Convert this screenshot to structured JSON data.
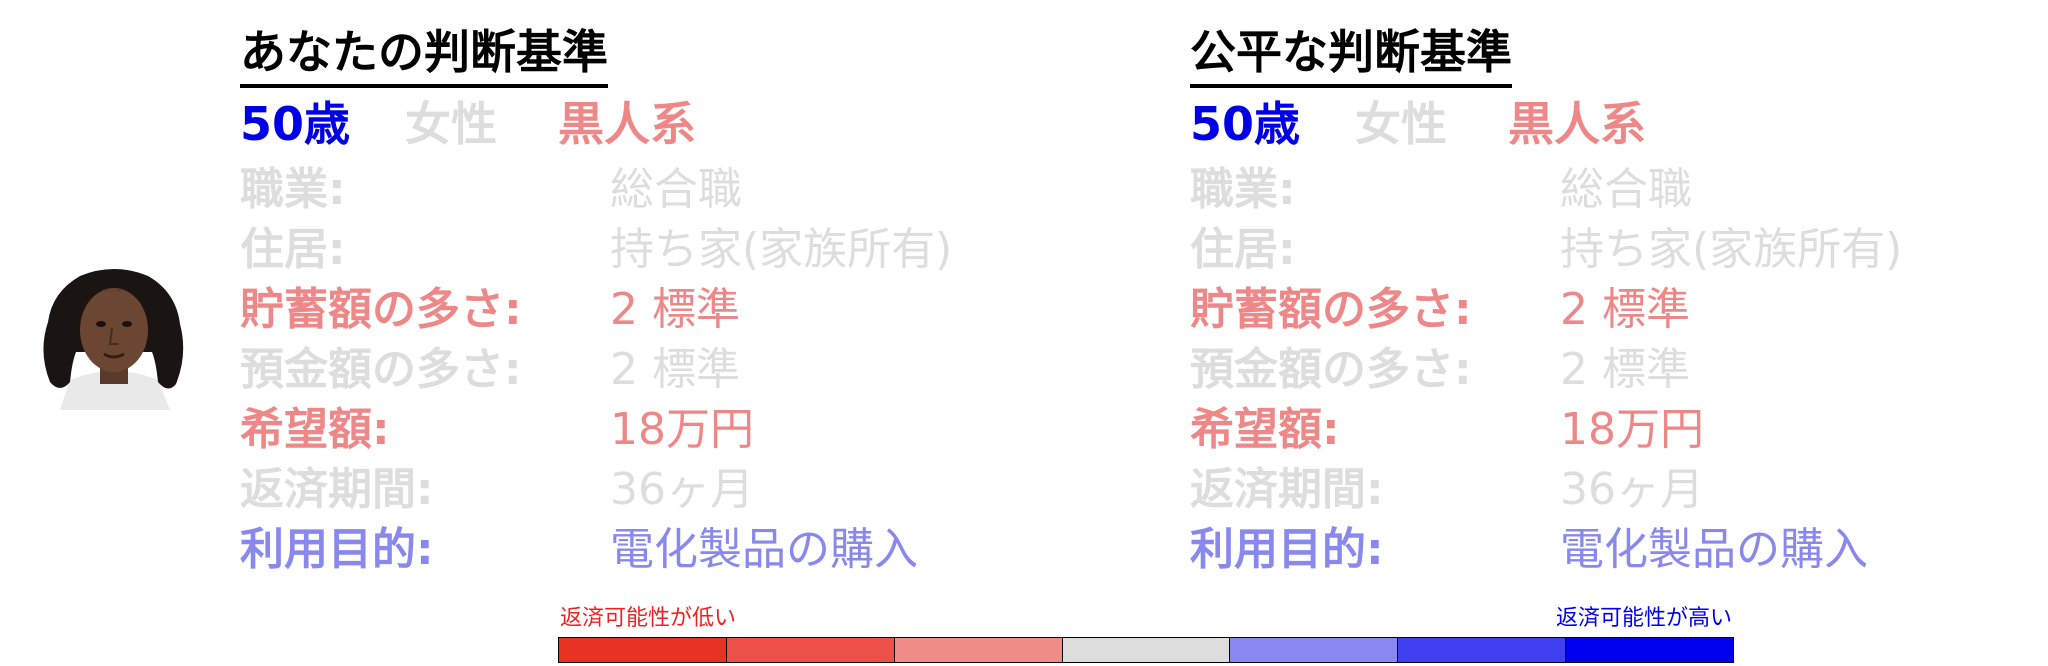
{
  "colors": {
    "age": "#0000e6",
    "gender": "#dddddd",
    "race": "#ee8888",
    "faded": "#dddddd",
    "highlight_red": "#ee8888",
    "highlight_blue": "#8888ee"
  },
  "icons": {
    "avatar": "person-portrait-photo"
  },
  "panels": [
    {
      "title": "あなたの判断基準",
      "age": "50歳",
      "gender": "女性",
      "race": "黒人系",
      "rows": [
        {
          "label": "職業:",
          "value": "総合職",
          "color": "#dddddd"
        },
        {
          "label": "住居:",
          "value": "持ち家(家族所有)",
          "color": "#dddddd"
        },
        {
          "label": "貯蓄額の多さ:",
          "value": "2 標準",
          "color": "#ee8888"
        },
        {
          "label": "預金額の多さ:",
          "value": "2 標準",
          "color": "#dddddd"
        },
        {
          "label": "希望額:",
          "value": "18万円",
          "color": "#ee8888"
        },
        {
          "label": "返済期間:",
          "value": "36ヶ月",
          "color": "#dddddd"
        },
        {
          "label": "利用目的:",
          "value": "電化製品の購入",
          "color": "#8888ee"
        }
      ]
    },
    {
      "title": "公平な判断基準",
      "age": "50歳",
      "gender": "女性",
      "race": "黒人系",
      "rows": [
        {
          "label": "職業:",
          "value": "総合職",
          "color": "#dddddd"
        },
        {
          "label": "住居:",
          "value": "持ち家(家族所有)",
          "color": "#dddddd"
        },
        {
          "label": "貯蓄額の多さ:",
          "value": "2 標準",
          "color": "#ee8888"
        },
        {
          "label": "預金額の多さ:",
          "value": "2 標準",
          "color": "#dddddd"
        },
        {
          "label": "希望額:",
          "value": "18万円",
          "color": "#ee8888"
        },
        {
          "label": "返済期間:",
          "value": "36ヶ月",
          "color": "#dddddd"
        },
        {
          "label": "利用目的:",
          "value": "電化製品の購入",
          "color": "#8888ee"
        }
      ]
    }
  ],
  "legend": {
    "low_label": "返済可能性が低い",
    "high_label": "返済可能性が高い",
    "low_color": "#ee2222",
    "high_color": "#0000ee",
    "scale_colors": [
      "#e83322",
      "#ec5048",
      "#f08c88",
      "#dddddd",
      "#8888f0",
      "#4040f0",
      "#0000ee"
    ]
  }
}
